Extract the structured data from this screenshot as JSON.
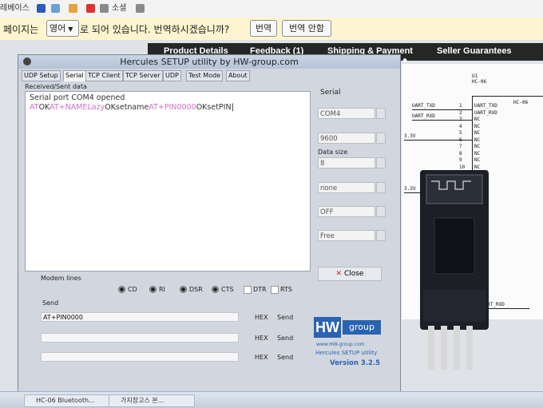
{
  "browser": {
    "bookmarks": [
      "레베이스",
      "소셜"
    ],
    "translate_bar": {
      "prefix": "페이지는",
      "language": "영어",
      "middle": "로 되어 있습니다. 번역하시겠습니까?",
      "translate_button": "번역",
      "no_translate_button": "번역 안함"
    }
  },
  "webpage": {
    "tabs": [
      "Product Details",
      "Feedback (1)",
      "Shipping & Payment",
      "Seller Guarantees"
    ]
  },
  "schematic": {
    "ref": "U1",
    "part": "HC-06",
    "chip_label": "HC-06",
    "pins_left": [
      "UART_TXD",
      "UART_RXD"
    ],
    "pins_right": [
      "UART_TXD",
      "UART_RXD",
      "NC",
      "NC",
      "NC",
      "NC",
      "NC",
      "NC",
      "NC",
      "NC"
    ],
    "pin_numbers": [
      "1",
      "2",
      "3",
      "4",
      "5",
      "6",
      "7",
      "8",
      "9",
      "10"
    ],
    "rail_labels": [
      "3.3V",
      "3.3V"
    ],
    "bottom_label": "UART_RXD"
  },
  "hercules": {
    "title": "Hercules SETUP utility by HW-group.com",
    "tabs": [
      "UDP Setup",
      "Serial",
      "TCP Client",
      "TCP Server",
      "UDP",
      "Test Mode",
      "About"
    ],
    "received_label": "Received/Sent data",
    "received_line1": "Serial port COM4 opened",
    "received_line2": [
      {
        "text": "AT",
        "sent": true
      },
      {
        "text": "OK",
        "sent": false
      },
      {
        "text": "AT+NAMELazy",
        "sent": true
      },
      {
        "text": "OKsetname",
        "sent": false
      },
      {
        "text": "AT+PIN0000",
        "sent": true
      },
      {
        "text": "OKsetPIN",
        "sent": false
      }
    ],
    "serial_group": "Serial",
    "serial_fields": [
      {
        "label": "",
        "value": "COM4"
      },
      {
        "label": "",
        "value": "9600"
      },
      {
        "label": "Data size",
        "value": "8"
      },
      {
        "label": "",
        "value": "none"
      },
      {
        "label": "",
        "value": "OFF"
      },
      {
        "label": "",
        "value": "Free"
      }
    ],
    "close_button": "Close",
    "modem_lines_label": "Modem lines",
    "modem_lines": [
      {
        "name": "CD",
        "on": true
      },
      {
        "name": "RI",
        "on": true
      },
      {
        "name": "DSR",
        "on": true
      },
      {
        "name": "CTS",
        "on": true
      },
      {
        "name": "DTR",
        "on": false
      },
      {
        "name": "RTS",
        "on": false
      }
    ],
    "send_label": "Send",
    "send_rows": [
      {
        "value": "AT+PIN0000",
        "hex": "HEX",
        "button": "Send"
      },
      {
        "value": "",
        "hex": "HEX",
        "button": "Send"
      },
      {
        "value": "",
        "hex": "HEX",
        "button": "Send"
      }
    ],
    "logo_text": "HW group",
    "logo_url": "www.HW-group.com",
    "product": "Hercules SETUP utility",
    "version": "Version 3.2.5"
  },
  "taskbar": {
    "items": [
      "HC-06 Bluetooth...",
      "가지창고스 본..."
    ]
  },
  "colors": {
    "sent_text": "#d36fcc",
    "received_text": "#333333",
    "logo_blue": "#2a63b0",
    "translate_bg": "#fdf5cf"
  }
}
